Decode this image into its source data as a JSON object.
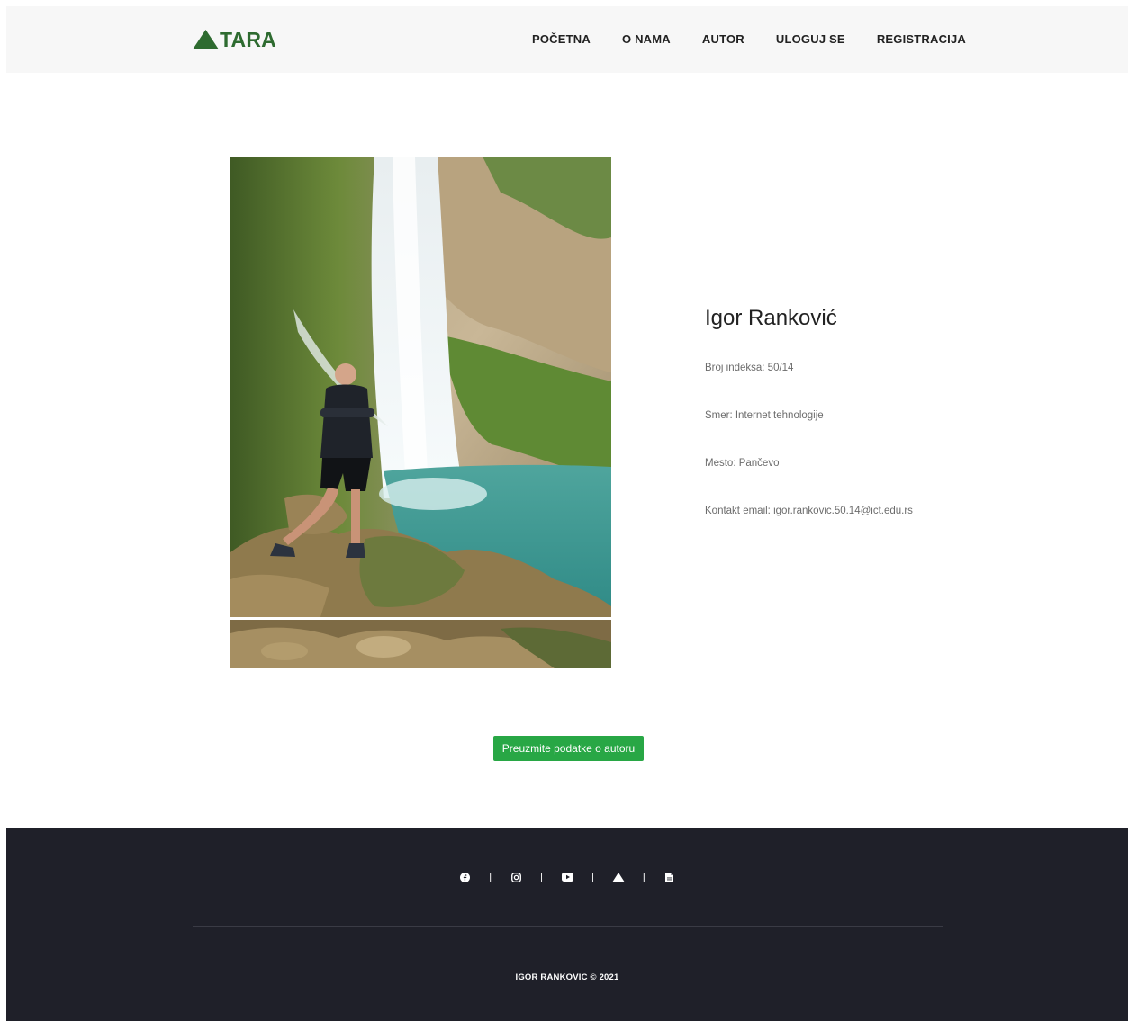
{
  "header": {
    "logo_text": "TARA",
    "nav": [
      {
        "label": "POČETNA"
      },
      {
        "label": "O NAMA"
      },
      {
        "label": "AUTOR"
      },
      {
        "label": "ULOGUJ SE"
      },
      {
        "label": "REGISTRACIJA"
      }
    ]
  },
  "author": {
    "name": "Igor Ranković",
    "index": "Broj indeksa: 50/14",
    "major": "Smer: Internet tehnologije",
    "city": "Mesto: Pančevo",
    "email": "Kontakt email: igor.rankovic.50.14@ict.edu.rs"
  },
  "download_button": "Preuzmite podatke o autoru",
  "footer": {
    "separator": "|",
    "icons": [
      "facebook-icon",
      "instagram-icon",
      "youtube-icon",
      "mountain-icon",
      "document-icon"
    ],
    "copyright": "IGOR RANKOVIC © 2021"
  },
  "colors": {
    "brand_green": "#2e6b30",
    "button_green": "#28a745",
    "footer_bg": "#1f2029",
    "header_bg": "#f7f7f7"
  }
}
